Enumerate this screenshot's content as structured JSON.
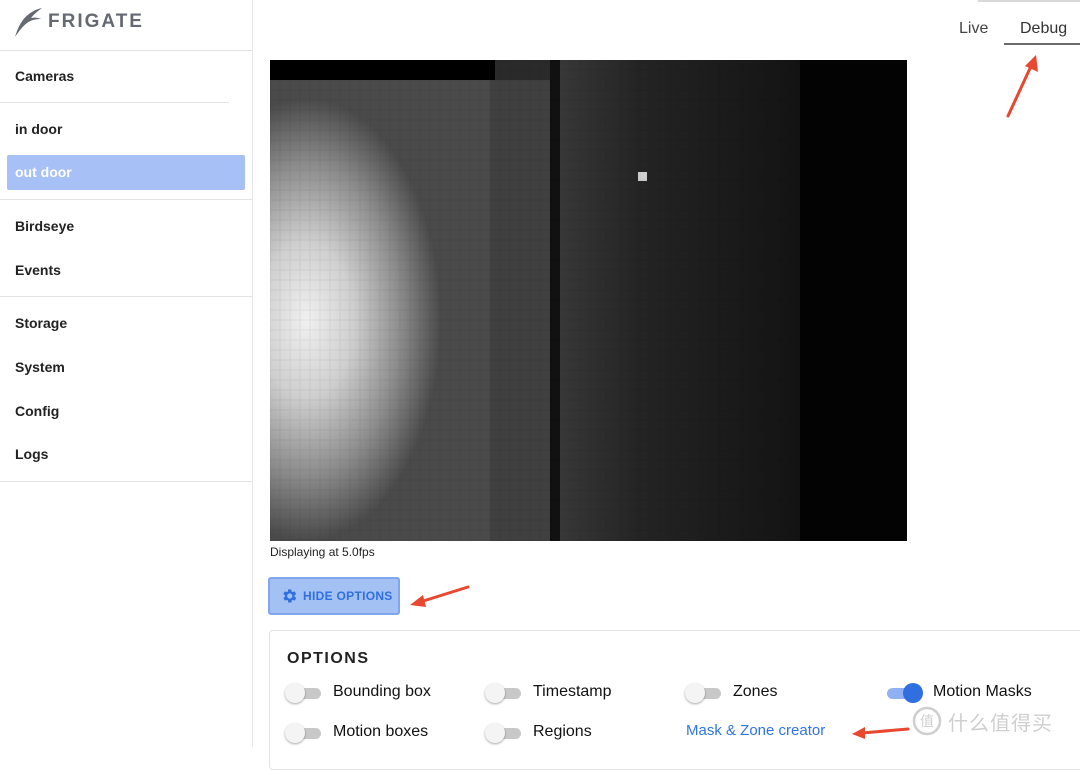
{
  "app": {
    "name": "FRIGATE"
  },
  "sidebar": {
    "items": [
      {
        "label": "Cameras"
      },
      {
        "label": "in door"
      },
      {
        "label": "out door",
        "active": true
      },
      {
        "label": "Birdseye"
      },
      {
        "label": "Events"
      },
      {
        "label": "Storage"
      },
      {
        "label": "System"
      },
      {
        "label": "Config"
      },
      {
        "label": "Logs"
      }
    ]
  },
  "tabs": [
    {
      "label": "Live",
      "active": false
    },
    {
      "label": "Debug",
      "active": true
    }
  ],
  "camera": {
    "fps_text": "Displaying at 5.0fps"
  },
  "options_button": {
    "label": "HIDE OPTIONS",
    "icon": "gear-icon"
  },
  "options": {
    "title": "OPTIONS",
    "toggles": [
      {
        "label": "Bounding box",
        "on": false
      },
      {
        "label": "Timestamp",
        "on": false
      },
      {
        "label": "Zones",
        "on": false
      },
      {
        "label": "Motion Masks",
        "on": true
      },
      {
        "label": "Motion boxes",
        "on": false
      },
      {
        "label": "Regions",
        "on": false
      }
    ],
    "link": "Mask & Zone creator"
  },
  "watermark": {
    "text": "什么值得买"
  },
  "colors": {
    "accent": "#2f6fe0",
    "active_nav_bg": "#a7c1f6",
    "annotation_arrow": "#e8482f"
  }
}
